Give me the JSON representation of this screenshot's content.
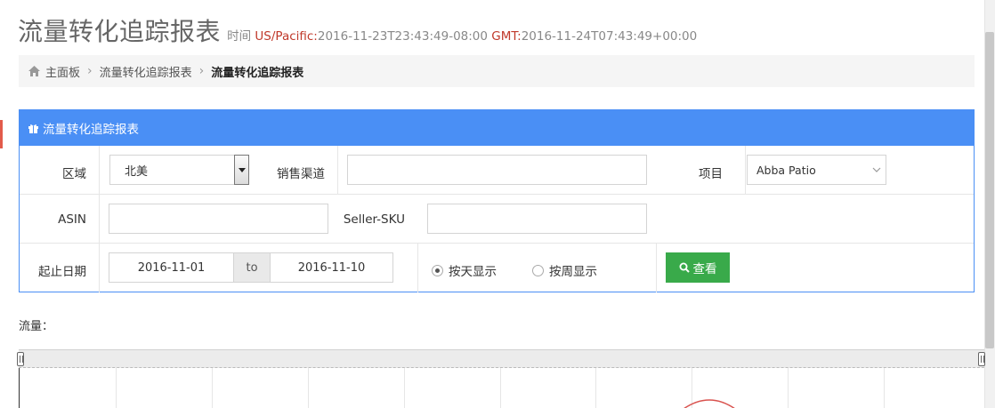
{
  "header": {
    "title": "流量转化追踪报表",
    "time_label": "时间",
    "tz_pacific_label": "US/Pacific:",
    "tz_pacific_value": "2016-11-23T23:43:49-08:00",
    "tz_gmt_label": "GMT:",
    "tz_gmt_value": "2016-11-24T07:43:49+00:00"
  },
  "breadcrumb": {
    "items": [
      "主面板",
      "流量转化追踪报表",
      "流量转化追踪报表"
    ]
  },
  "panel": {
    "title": "流量转化追踪报表",
    "region_label": "区域",
    "region_value": "北美",
    "channel_label": "销售渠道",
    "channel_value": "",
    "project_label": "项目",
    "project_value": "Abba Patio",
    "asin_label": "ASIN",
    "asin_value": "",
    "sku_label": "Seller-SKU",
    "sku_value": "",
    "date_label": "起止日期",
    "date_start": "2016-11-01",
    "date_to": "to",
    "date_end": "2016-11-10",
    "radio_day_label": "按天显示",
    "radio_week_label": "按周显示",
    "query_button": "查看"
  },
  "chart": {
    "flow_label": "流量："
  },
  "colors": {
    "panel_header": "#4a8ff5",
    "query_button": "#39aa4a",
    "timezone_text": "#c0392b"
  }
}
